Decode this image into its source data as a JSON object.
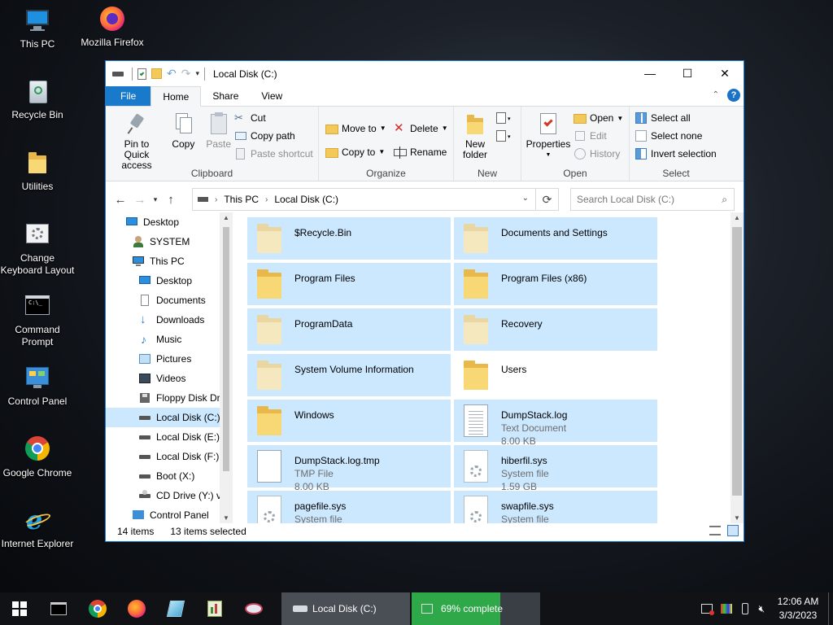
{
  "desktop": {
    "icons": [
      {
        "label": "This PC",
        "icon": "this-pc-icon"
      },
      {
        "label": "Mozilla Firefox",
        "icon": "firefox-icon"
      },
      {
        "label": "Recycle Bin",
        "icon": "recycle-bin-icon"
      },
      {
        "label": "Utilities",
        "icon": "folder-icon"
      },
      {
        "label": "Change Keyboard Layout",
        "icon": "keyboard-settings-icon"
      },
      {
        "label": "Command Prompt",
        "icon": "command-prompt-icon"
      },
      {
        "label": "Control Panel",
        "icon": "control-panel-icon"
      },
      {
        "label": "Google Chrome",
        "icon": "chrome-icon"
      },
      {
        "label": "Internet Explorer",
        "icon": "internet-explorer-icon"
      }
    ]
  },
  "window": {
    "title": "Local Disk (C:)",
    "accent": "#1979ca",
    "selection_color": "#cce8ff",
    "controls": {
      "minimize": "—",
      "maximize": "☐",
      "close": "✕"
    },
    "tabs": [
      "File",
      "Home",
      "Share",
      "View"
    ],
    "active_tab": "Home",
    "ribbon": {
      "clipboard": {
        "label": "Clipboard",
        "pin": "Pin to Quick access",
        "copy": "Copy",
        "paste": "Paste",
        "cut": "Cut",
        "copy_path": "Copy path",
        "paste_shortcut": "Paste shortcut"
      },
      "organize": {
        "label": "Organize",
        "move_to": "Move to",
        "copy_to": "Copy to",
        "delete": "Delete",
        "rename": "Rename"
      },
      "new": {
        "label": "New",
        "new_folder": "New folder"
      },
      "open": {
        "label": "Open",
        "properties": "Properties",
        "open": "Open",
        "edit": "Edit",
        "history": "History"
      },
      "select": {
        "label": "Select",
        "select_all": "Select all",
        "select_none": "Select none",
        "invert": "Invert selection"
      }
    },
    "address": {
      "crumbs": [
        "This PC",
        "Local Disk (C:)"
      ],
      "search_placeholder": "Search Local Disk (C:)"
    },
    "nav": [
      {
        "label": "Desktop",
        "icon": "desktop-icon",
        "indent": 0
      },
      {
        "label": "SYSTEM",
        "icon": "user-icon",
        "indent": 1
      },
      {
        "label": "This PC",
        "icon": "this-pc-icon",
        "indent": 1
      },
      {
        "label": "Desktop",
        "icon": "desktop-icon",
        "indent": 2
      },
      {
        "label": "Documents",
        "icon": "documents-icon",
        "indent": 2
      },
      {
        "label": "Downloads",
        "icon": "downloads-icon",
        "indent": 2
      },
      {
        "label": "Music",
        "icon": "music-icon",
        "indent": 2
      },
      {
        "label": "Pictures",
        "icon": "pictures-icon",
        "indent": 2
      },
      {
        "label": "Videos",
        "icon": "videos-icon",
        "indent": 2
      },
      {
        "label": "Floppy Disk Dri",
        "icon": "floppy-icon",
        "indent": 2
      },
      {
        "label": "Local Disk (C:)",
        "icon": "drive-icon",
        "indent": 2,
        "selected": true
      },
      {
        "label": "Local Disk (E:)",
        "icon": "drive-icon",
        "indent": 2
      },
      {
        "label": "Local Disk (F:)",
        "icon": "drive-icon",
        "indent": 2
      },
      {
        "label": "Boot (X:)",
        "icon": "drive-icon",
        "indent": 2
      },
      {
        "label": "CD Drive (Y:) vi",
        "icon": "cd-drive-icon",
        "indent": 2
      },
      {
        "label": "Control Panel",
        "icon": "control-panel-icon",
        "indent": 1
      }
    ],
    "files": [
      {
        "name": "$Recycle.Bin",
        "type": "",
        "size": "",
        "icon": "folder-faded",
        "selected": true
      },
      {
        "name": "Documents and Settings",
        "type": "",
        "size": "",
        "icon": "folder-faded",
        "selected": true
      },
      {
        "name": "Program Files",
        "type": "",
        "size": "",
        "icon": "folder",
        "selected": true
      },
      {
        "name": "Program Files (x86)",
        "type": "",
        "size": "",
        "icon": "folder",
        "selected": true
      },
      {
        "name": "ProgramData",
        "type": "",
        "size": "",
        "icon": "folder-faded",
        "selected": true
      },
      {
        "name": "Recovery",
        "type": "",
        "size": "",
        "icon": "folder-faded",
        "selected": true
      },
      {
        "name": "System Volume Information",
        "type": "",
        "size": "",
        "icon": "folder-faded",
        "selected": true
      },
      {
        "name": "Users",
        "type": "",
        "size": "",
        "icon": "folder",
        "selected": false
      },
      {
        "name": "Windows",
        "type": "",
        "size": "",
        "icon": "folder",
        "selected": true
      },
      {
        "name": "DumpStack.log",
        "type": "Text Document",
        "size": "8.00 KB",
        "icon": "text-doc",
        "selected": true
      },
      {
        "name": "DumpStack.log.tmp",
        "type": "TMP File",
        "size": "8.00 KB",
        "icon": "blank-doc",
        "selected": true
      },
      {
        "name": "hiberfil.sys",
        "type": "System file",
        "size": "1.59 GB",
        "icon": "sys-doc",
        "selected": true
      },
      {
        "name": "pagefile.sys",
        "type": "System file",
        "size": "",
        "icon": "sys-doc",
        "selected": true
      },
      {
        "name": "swapfile.sys",
        "type": "System file",
        "size": "",
        "icon": "sys-doc",
        "selected": true
      }
    ],
    "status": {
      "count": "14 items",
      "selected": "13 items selected"
    }
  },
  "taskbar": {
    "apps": [
      {
        "label": "Local Disk (C:)",
        "icon": "drive-icon"
      },
      {
        "label": "69% complete",
        "icon": "copy-progress-icon",
        "progress": 0.69
      }
    ],
    "clock": {
      "time": "12:06 AM",
      "date": "3/3/2023"
    }
  }
}
